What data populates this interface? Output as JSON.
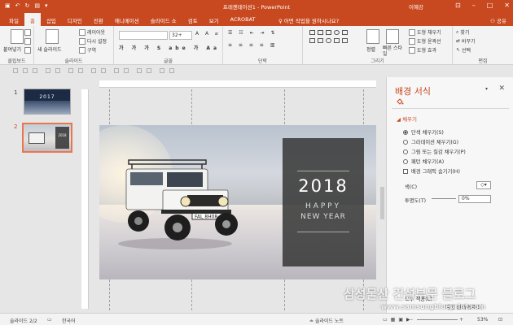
{
  "window": {
    "title": "프레젠테이션1 - PowerPoint",
    "user": "이혜강"
  },
  "tabs": [
    "파일",
    "홈",
    "삽입",
    "디자인",
    "전환",
    "애니메이션",
    "슬라이드 쇼",
    "검토",
    "보기",
    "ACROBAT"
  ],
  "active_tab": "홈",
  "tell_me": "어떤 작업을 원하시나요?",
  "share": "공유",
  "ribbon": {
    "groups": [
      "클립보드",
      "슬라이드",
      "글꼴",
      "단락",
      "그리기",
      "편집"
    ],
    "paste": "붙여넣기",
    "new_slide": "새 슬라이드",
    "layout": "레이아웃",
    "reset": "다시 설정",
    "section": "구역",
    "font_size": "32+",
    "arrange": "정렬",
    "quick_styles": "빠른 스타일",
    "shape_fill": "도형 채우기",
    "shape_outline": "도형 윤곽선",
    "shape_effects": "도형 효과",
    "find": "찾기",
    "replace": "바꾸기",
    "select": "선택"
  },
  "thumbnails": [
    {
      "number": "1",
      "text": "2017"
    },
    {
      "number": "2",
      "text": "2018"
    }
  ],
  "slide": {
    "year": "2018",
    "line1": "HAPPY",
    "line2": "NEW YEAR",
    "plate": "FAL 8H08"
  },
  "format_pane": {
    "title": "배경 서식",
    "section": "채우기",
    "options": [
      {
        "label": "단색 채우기(S)",
        "selected": true
      },
      {
        "label": "그라데이션 채우기(G)",
        "selected": false
      },
      {
        "label": "그림 또는 질감 채우기(P)",
        "selected": false
      },
      {
        "label": "패턴 채우기(A)",
        "selected": false
      }
    ],
    "hide_graphics": "배경 그래픽 숨기기(H)",
    "color_label": "색(C)",
    "transparency_label": "투명도(T)",
    "transparency_value": "0%",
    "apply_all": "모두 적용(L)",
    "reset_background": "배경 원래대로(B)"
  },
  "status": {
    "slide_info": "슬라이드 2/2",
    "language": "한국어",
    "notes": "슬라이드 노트",
    "zoom": "53%"
  },
  "watermark": {
    "line1": "삼성물산 건설부문 블로그",
    "line2": "www.samsungblueprint.com"
  }
}
